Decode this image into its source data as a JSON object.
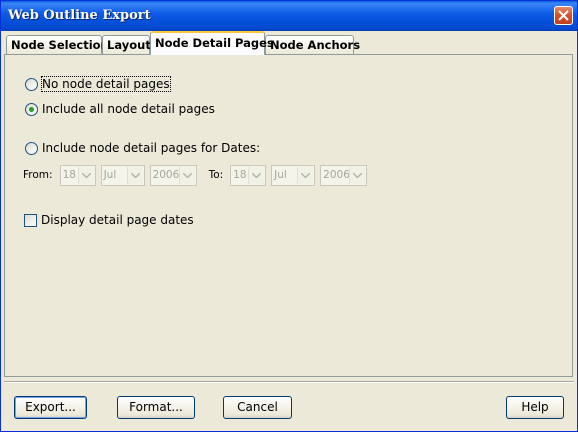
{
  "window": {
    "title": "Web Outline Export"
  },
  "tabs": [
    {
      "label": "Node Selection"
    },
    {
      "label": "Layout"
    },
    {
      "label": "Node Detail Pages"
    },
    {
      "label": "Node Anchors"
    }
  ],
  "active_tab": "Node Detail Pages",
  "options": {
    "no_pages": "No node detail pages",
    "all_pages": "Include all node detail pages",
    "dates_pages": "Include node detail pages for Dates:",
    "selected": "Include all node detail pages"
  },
  "dates": {
    "from_label": "From:",
    "to_label": "To:",
    "from": {
      "day": "18",
      "month": "Jul",
      "year": "2006"
    },
    "to": {
      "day": "18",
      "month": "Jul",
      "year": "2006"
    }
  },
  "display_dates": {
    "label": "Display detail page dates",
    "checked": false
  },
  "buttons": {
    "export": "Export...",
    "format": "Format...",
    "cancel": "Cancel",
    "help": "Help"
  }
}
